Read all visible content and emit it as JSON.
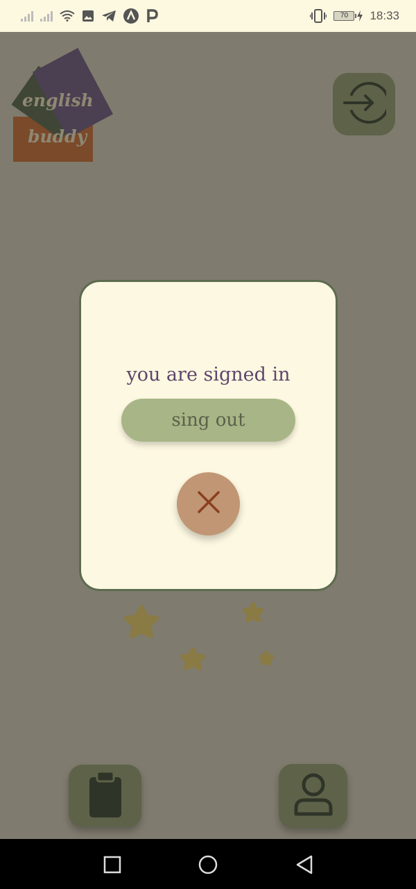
{
  "status_bar": {
    "time": "18:33",
    "battery_level": "70",
    "left_icons": [
      "signal-icon",
      "signal-icon",
      "wifi-icon",
      "image-icon",
      "telegram-icon",
      "app-a-icon",
      "app-p-icon"
    ],
    "right_icons": [
      "vibrate-icon",
      "battery-icon",
      "charging-icon"
    ]
  },
  "app": {
    "logo": {
      "line1": "english",
      "line2": "buddy"
    },
    "login_icon": "login-arrow-icon",
    "nav": {
      "tasks_icon": "clipboard-icon",
      "profile_icon": "user-icon"
    }
  },
  "dialog": {
    "message": "you are signed in",
    "signout_label": "sing out",
    "close_icon": "close-icon"
  },
  "system_nav": {
    "recents_icon": "square-icon",
    "home_icon": "circle-icon",
    "back_icon": "triangle-back-icon"
  },
  "colors": {
    "overlay_bg": "#7f7b6e",
    "dialog_bg": "#fdf8e1",
    "dialog_border": "#5c6b4f",
    "message_text": "#5e466b",
    "signout_bg": "#a8b587",
    "close_bg": "#c09674",
    "close_x": "#8a3f1e",
    "nav_button_bg": "#5e6249",
    "star": "#8a7a44"
  }
}
